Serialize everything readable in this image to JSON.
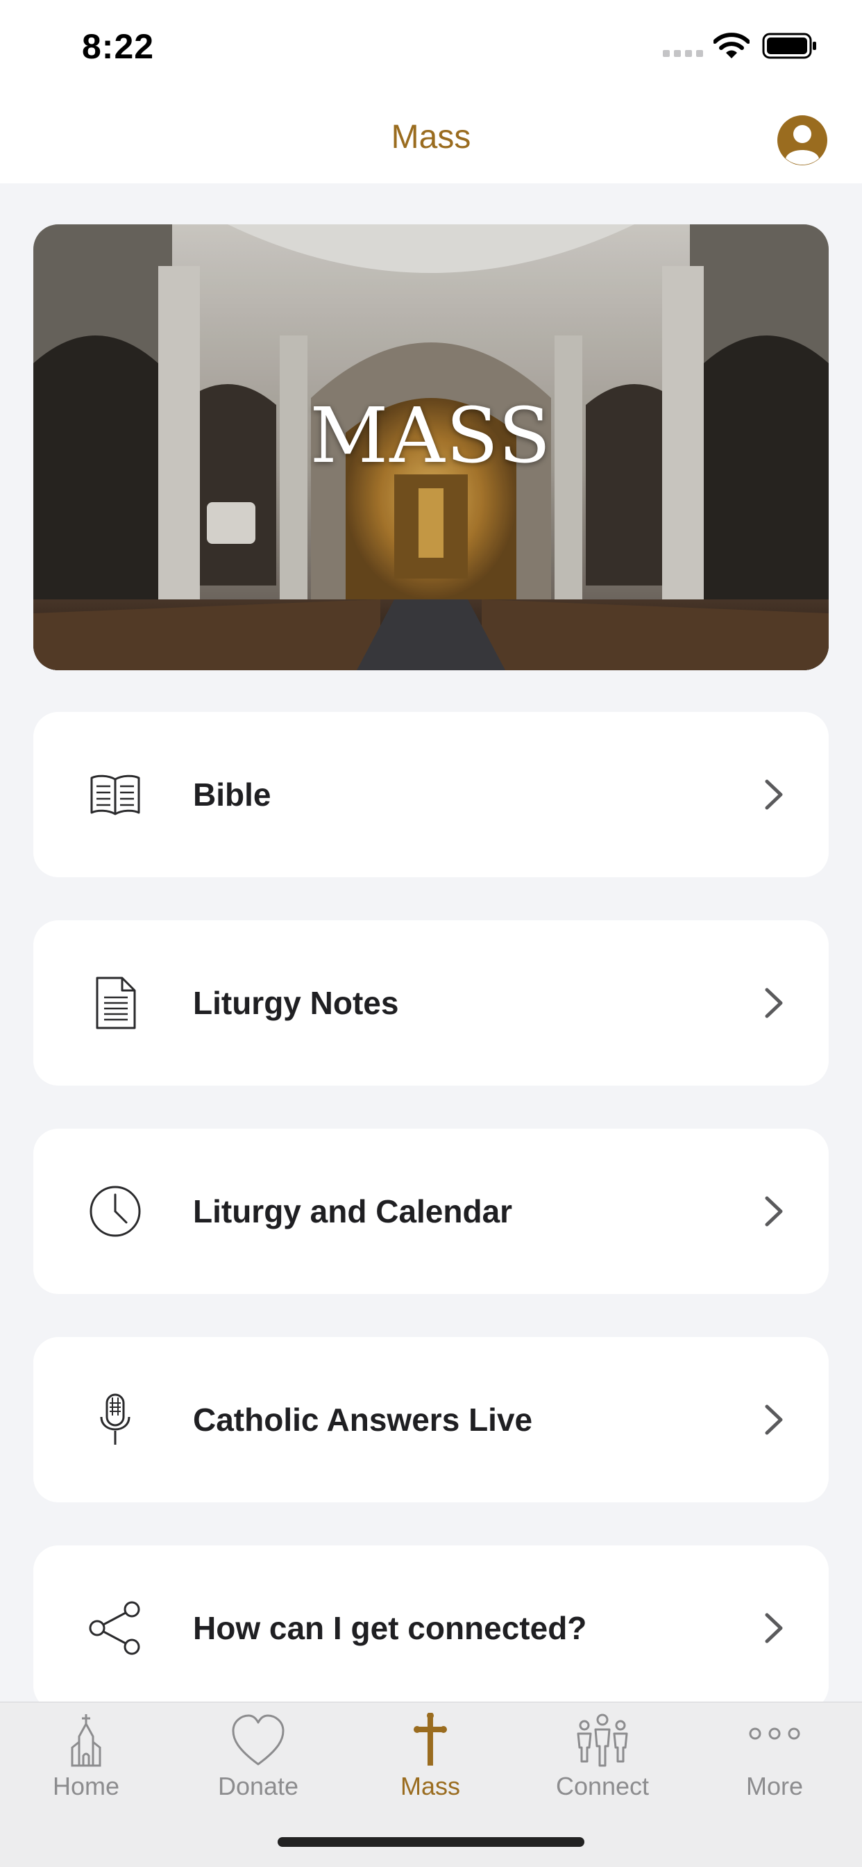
{
  "status_bar": {
    "time": "8:22"
  },
  "header": {
    "title": "Mass",
    "profile_icon": "person-circle-icon"
  },
  "hero": {
    "title": "MASS",
    "image": "church-interior-photo"
  },
  "menu": [
    {
      "label": "Bible",
      "icon": "open-book-icon"
    },
    {
      "label": "Liturgy Notes",
      "icon": "document-icon"
    },
    {
      "label": "Liturgy and Calendar",
      "icon": "clock-icon"
    },
    {
      "label": "Catholic Answers Live",
      "icon": "microphone-icon"
    },
    {
      "label": "How can I get connected?",
      "icon": "share-icon"
    }
  ],
  "tabs": [
    {
      "label": "Home",
      "icon": "church-icon",
      "active": false
    },
    {
      "label": "Donate",
      "icon": "heart-icon",
      "active": false
    },
    {
      "label": "Mass",
      "icon": "cross-icon",
      "active": true
    },
    {
      "label": "Connect",
      "icon": "people-icon",
      "active": false
    },
    {
      "label": "More",
      "icon": "more-dots-icon",
      "active": false
    }
  ],
  "colors": {
    "accent": "#9a6c1f",
    "background": "#f3f4f7",
    "card": "#ffffff",
    "tab_inactive": "#8c8c8e"
  }
}
